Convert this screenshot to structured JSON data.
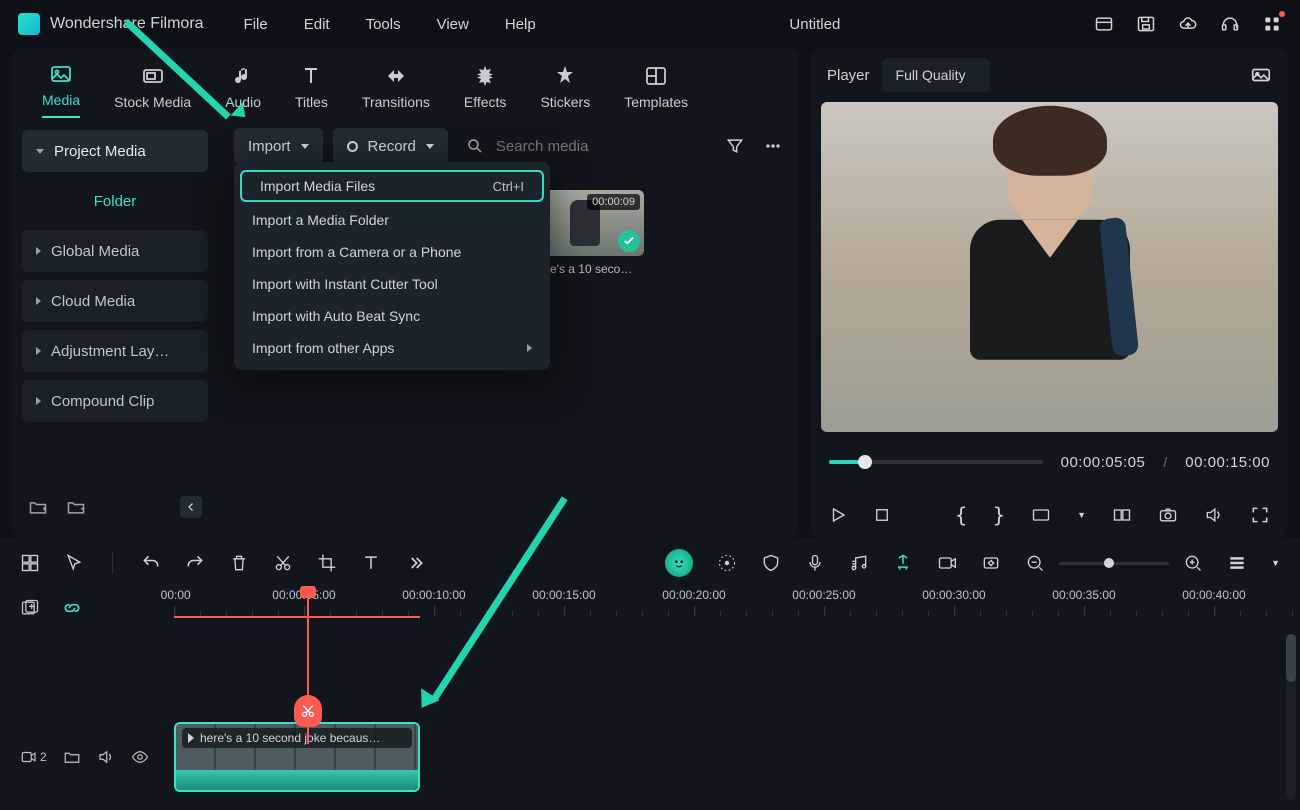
{
  "app_name": "Wondershare Filmora",
  "menu": {
    "file": "File",
    "edit": "Edit",
    "tools": "Tools",
    "view": "View",
    "help": "Help"
  },
  "doc_title": "Untitled",
  "tabs": {
    "media": "Media",
    "stock": "Stock Media",
    "audio": "Audio",
    "titles": "Titles",
    "transitions": "Transitions",
    "effects": "Effects",
    "stickers": "Stickers",
    "templates": "Templates"
  },
  "sidebar": {
    "project": "Project Media",
    "folder": "Folder",
    "global": "Global Media",
    "cloud": "Cloud Media",
    "adjust": "Adjustment Lay…",
    "compound": "Compound Clip"
  },
  "toolbar": {
    "import": "Import",
    "record": "Record",
    "search_ph": "Search media"
  },
  "import_menu": {
    "files": "Import Media Files",
    "files_sc": "Ctrl+I",
    "folder": "Import a Media Folder",
    "camera": "Import from a Camera or a Phone",
    "cutter": "Import with Instant Cutter Tool",
    "beat": "Import with Auto Beat Sync",
    "apps": "Import from other Apps"
  },
  "media": {
    "dur": "00:00:09",
    "name": "…re's a 10 seco…"
  },
  "preview": {
    "player": "Player",
    "quality": "Full Quality",
    "current": "00:00:05:05",
    "total": "00:00:15:00"
  },
  "ruler": [
    ":00:00",
    "00:00:05:00",
    "00:00:10:00",
    "00:00:15:00",
    "00:00:20:00",
    "00:00:25:00",
    "00:00:30:00",
    "00:00:35:00",
    "00:00:40:00"
  ],
  "clip": {
    "label": "here's a 10 second joke becaus…"
  },
  "track_badge": "2"
}
